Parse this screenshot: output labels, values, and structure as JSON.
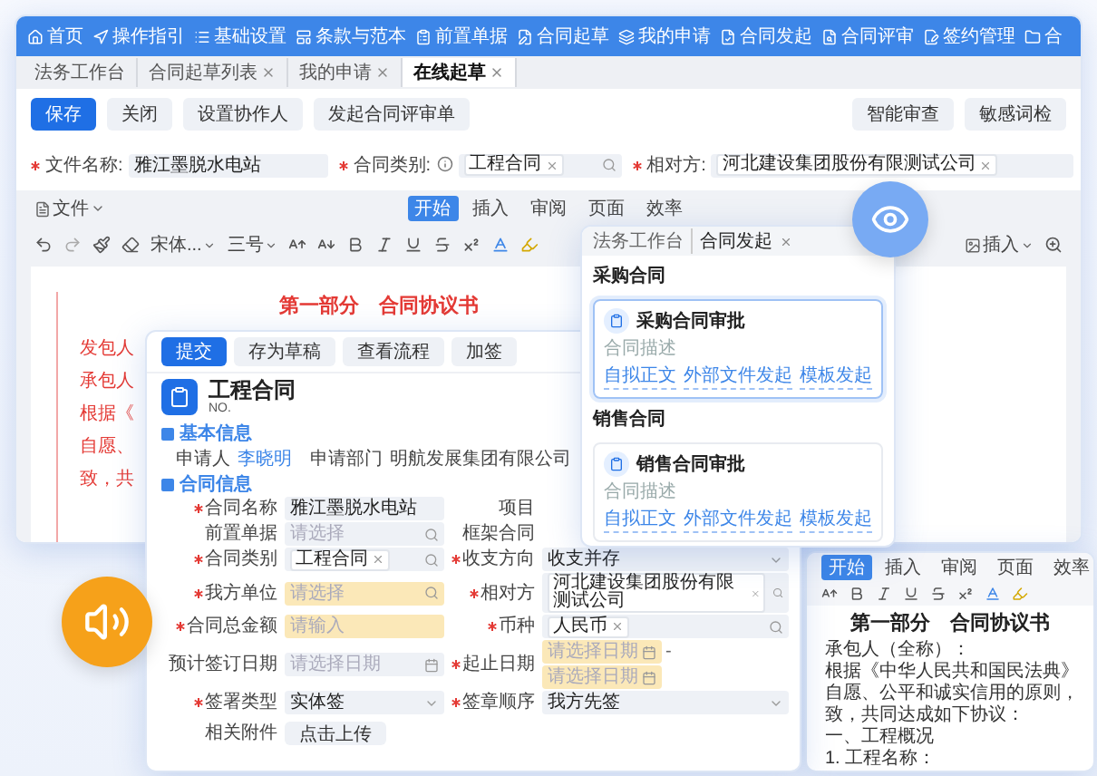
{
  "nav": [
    "首页",
    "操作指引",
    "基础设置",
    "条款与范本",
    "前置单据",
    "合同起草",
    "我的申请",
    "合同发起",
    "合同评审",
    "签约管理",
    "合"
  ],
  "tabs": [
    {
      "label": "法务工作台",
      "closable": false,
      "selected": false
    },
    {
      "label": "合同起草列表",
      "closable": true,
      "selected": false
    },
    {
      "label": "我的申请",
      "closable": true,
      "selected": false
    },
    {
      "label": "在线起草",
      "closable": true,
      "selected": true
    }
  ],
  "actions": [
    {
      "label": "保存",
      "primary": true
    },
    {
      "label": "关闭",
      "primary": false
    },
    {
      "label": "设置协作人",
      "primary": false
    },
    {
      "label": "发起合同评审单",
      "primary": false
    }
  ],
  "tools": [
    "智能审查",
    "敏感词检"
  ],
  "fields": [
    {
      "label": "文件名称:",
      "required": true,
      "info": false,
      "kind": "text",
      "value": "雅江墨脱水电站"
    },
    {
      "label": "合同类别:",
      "required": true,
      "info": true,
      "kind": "tag-search",
      "value": "工程合同"
    },
    {
      "label": "相对方:",
      "required": true,
      "info": false,
      "kind": "tag",
      "value": "河北建设集团股份有限测试公司"
    }
  ],
  "editor": {
    "file_menu": "文件",
    "tabs": [
      {
        "label": "开始",
        "selected": true
      },
      {
        "label": "插入",
        "selected": false
      },
      {
        "label": "审阅",
        "selected": false
      },
      {
        "label": "页面",
        "selected": false
      },
      {
        "label": "效率",
        "selected": false
      }
    ],
    "font": "宋体...",
    "size": "三号",
    "insert": "插入"
  },
  "document": {
    "title": "第一部分　合同协议书",
    "lines": [
      "发包人",
      "承包人",
      "根据《",
      "自愿、",
      "致，共"
    ]
  },
  "popup": {
    "breadcrumb": [
      "法务工作台",
      "合同发起"
    ],
    "groups": [
      {
        "title": "采购合同",
        "card": "采购合同审批",
        "description": "合同描述",
        "links": [
          "自拟正文",
          "外部文件发起",
          "模板发起"
        ],
        "selected": true
      },
      {
        "title": "销售合同",
        "card": "销售合同审批",
        "description": "合同描述",
        "links": [
          "自拟正文",
          "外部文件发起",
          "模板发起"
        ],
        "selected": false
      }
    ]
  },
  "form": {
    "actions": [
      {
        "label": "提交",
        "primary": true
      },
      {
        "label": "存为草稿",
        "primary": false
      },
      {
        "label": "查看流程",
        "primary": false
      },
      {
        "label": "加签",
        "primary": false
      }
    ],
    "title": "工程合同",
    "number": "NO.",
    "basic": {
      "title": "基本信息",
      "items": [
        {
          "label": "申请人",
          "value": "李晓明",
          "link": true
        },
        {
          "label": "申请部门",
          "value": "明航发展集团有限公司",
          "link": false
        }
      ]
    },
    "contract": {
      "title": "合同信息",
      "left": [
        {
          "label": "合同名称",
          "required": true,
          "highlight": false,
          "kind": "text",
          "value": "雅江墨脱水电站"
        },
        {
          "label": "前置单据",
          "required": false,
          "highlight": false,
          "kind": "search",
          "placeholder": "请选择"
        },
        {
          "label": "合同类别",
          "required": true,
          "highlight": false,
          "kind": "tag-search",
          "value": "工程合同"
        },
        {
          "label": "我方单位",
          "required": true,
          "highlight": true,
          "kind": "search",
          "placeholder": "请选择"
        },
        {
          "label": "合同总金额",
          "required": true,
          "highlight": true,
          "kind": "text",
          "placeholder": "请输入"
        },
        {
          "label": "预计签订日期",
          "required": false,
          "highlight": false,
          "kind": "date",
          "placeholder": "请选择日期"
        },
        {
          "label": "签署类型",
          "required": true,
          "highlight": false,
          "kind": "select",
          "value": "实体签"
        },
        {
          "label": "相关附件",
          "required": false,
          "highlight": false,
          "kind": "upload",
          "value": "点击上传"
        }
      ],
      "right": [
        {
          "label": "项目",
          "required": false
        },
        {
          "label": "框架合同",
          "required": false
        },
        {
          "label": "收支方向",
          "required": true,
          "highlight": false,
          "kind": "select",
          "value": "收支并存"
        },
        {
          "label": "相对方",
          "required": true,
          "highlight": false,
          "kind": "tag-search",
          "value": "河北建设集团股份有限测试公司"
        },
        {
          "label": "币种",
          "required": true,
          "highlight": false,
          "kind": "tag-search",
          "value": "人民币"
        },
        {
          "label": "起止日期",
          "required": true,
          "highlight": true,
          "kind": "daterange",
          "placeholder": "请选择日期",
          "placeholder_end": "请选择日期",
          "separator": "-"
        },
        {
          "label": "签章顺序",
          "required": true,
          "highlight": false,
          "kind": "select",
          "value": "我方先签"
        }
      ]
    }
  },
  "doc": {
    "tabs": [
      {
        "label": "开始",
        "selected": true
      },
      {
        "label": "插入",
        "selected": false
      },
      {
        "label": "审阅",
        "selected": false
      },
      {
        "label": "页面",
        "selected": false
      },
      {
        "label": "效率",
        "selected": false
      }
    ],
    "title": "第一部分　合同协议书",
    "lines": [
      "承包人（全称）：",
      "根据《中华人民共和国民法典》",
      "自愿、公平和诚实信用的原则，",
      "致，共同达成如下协议：",
      "一、工程概况",
      "1. 工程名称："
    ]
  }
}
